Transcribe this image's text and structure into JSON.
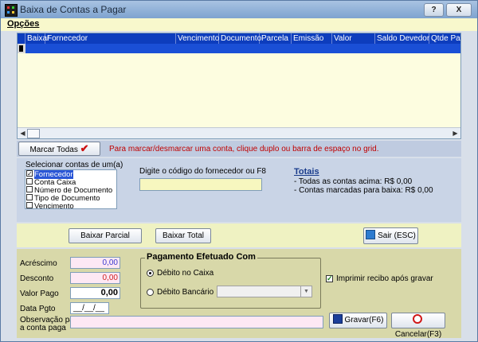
{
  "window": {
    "title": "Baixa de Contas a Pagar",
    "help_label": "?",
    "close_label": "X"
  },
  "menu": {
    "opcoes": "Opções"
  },
  "grid": {
    "columns": [
      "Baixar",
      "Fornecedor",
      "Vencimento",
      "Documento",
      "Parcela",
      "Emissão",
      "Valor",
      "Saldo Devedor",
      "Qtde Parc."
    ]
  },
  "marcar": {
    "button_label": "Marcar Todas",
    "hint": "Para marcar/desmarcar uma conta, clique duplo ou barra de espaço no grid."
  },
  "selecionar": {
    "label": "Selecionar contas de um(a)",
    "options": [
      {
        "label": "Fornecedor",
        "checked": true
      },
      {
        "label": "Conta Caixa",
        "checked": false
      },
      {
        "label": "Número de Documento",
        "checked": false
      },
      {
        "label": "Tipo de Documento",
        "checked": false
      },
      {
        "label": "Vencimento",
        "checked": false
      }
    ],
    "code_label": "Digite o código do fornecedor ou F8",
    "code_value": ""
  },
  "totais": {
    "title": "Totais",
    "todas": "- Todas as contas acima: R$ 0,00",
    "marcadas": "- Contas marcadas para baixa: R$ 0,00"
  },
  "actions": {
    "baixar_parcial": "Baixar Parcial",
    "baixar_total": "Baixar Total",
    "sair": "Sair (ESC)"
  },
  "form": {
    "acrescimo_label": "Acréscimo",
    "acrescimo_value": "0,00",
    "desconto_label": "Desconto",
    "desconto_value": "0,00",
    "valor_pago_label": "Valor Pago",
    "valor_pago_value": "0,00",
    "data_pgto_label": "Data Pgto",
    "data_pgto_value": "__/__/__",
    "observacao_label_1": "Observação para",
    "observacao_label_2": "a conta paga",
    "observacao_value": ""
  },
  "pagamento": {
    "title": "Pagamento Efetuado Com",
    "debito_caixa": "Débito no Caixa",
    "debito_bancario": "Débito Bancário",
    "selected": "debito_caixa"
  },
  "imprimir": {
    "label": "Imprimir recibo após gravar",
    "checked": true
  },
  "buttons": {
    "gravar": "Gravar(F6)",
    "cancelar": "Cancelar(F3)"
  },
  "colors": {
    "header_blue": "#0d3dbd",
    "grid_bg": "#fdfde0",
    "hint_red": "#c00000"
  }
}
